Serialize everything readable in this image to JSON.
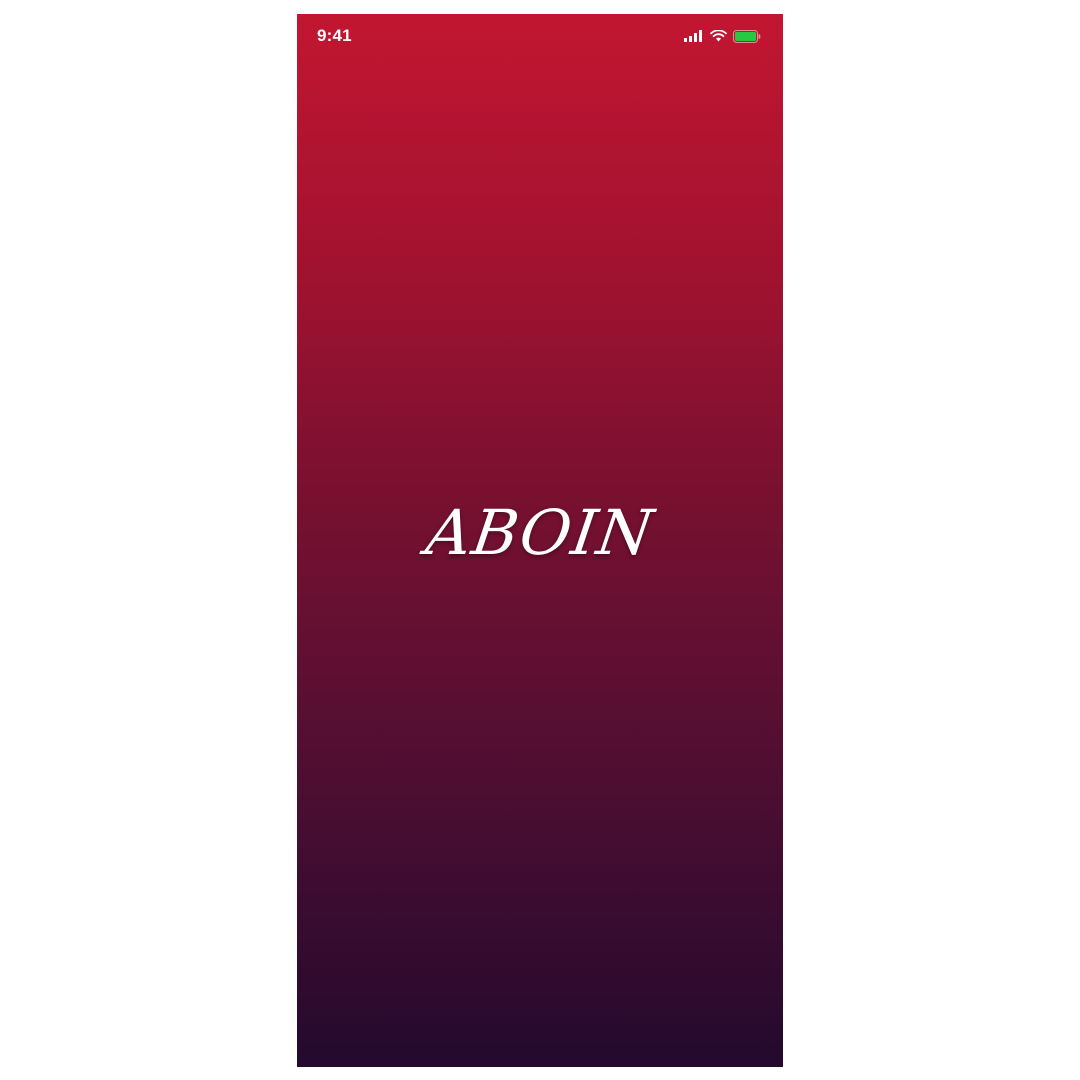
{
  "status_bar": {
    "time": "9:41",
    "icons": [
      "signal-icon",
      "wifi-icon",
      "battery-icon"
    ],
    "battery_color": "#28c840"
  },
  "splash": {
    "logo_text": "ABOIN"
  },
  "colors": {
    "gradient_top": "#c21631",
    "gradient_bottom": "#230a2e",
    "page_background": "#ffffff"
  }
}
